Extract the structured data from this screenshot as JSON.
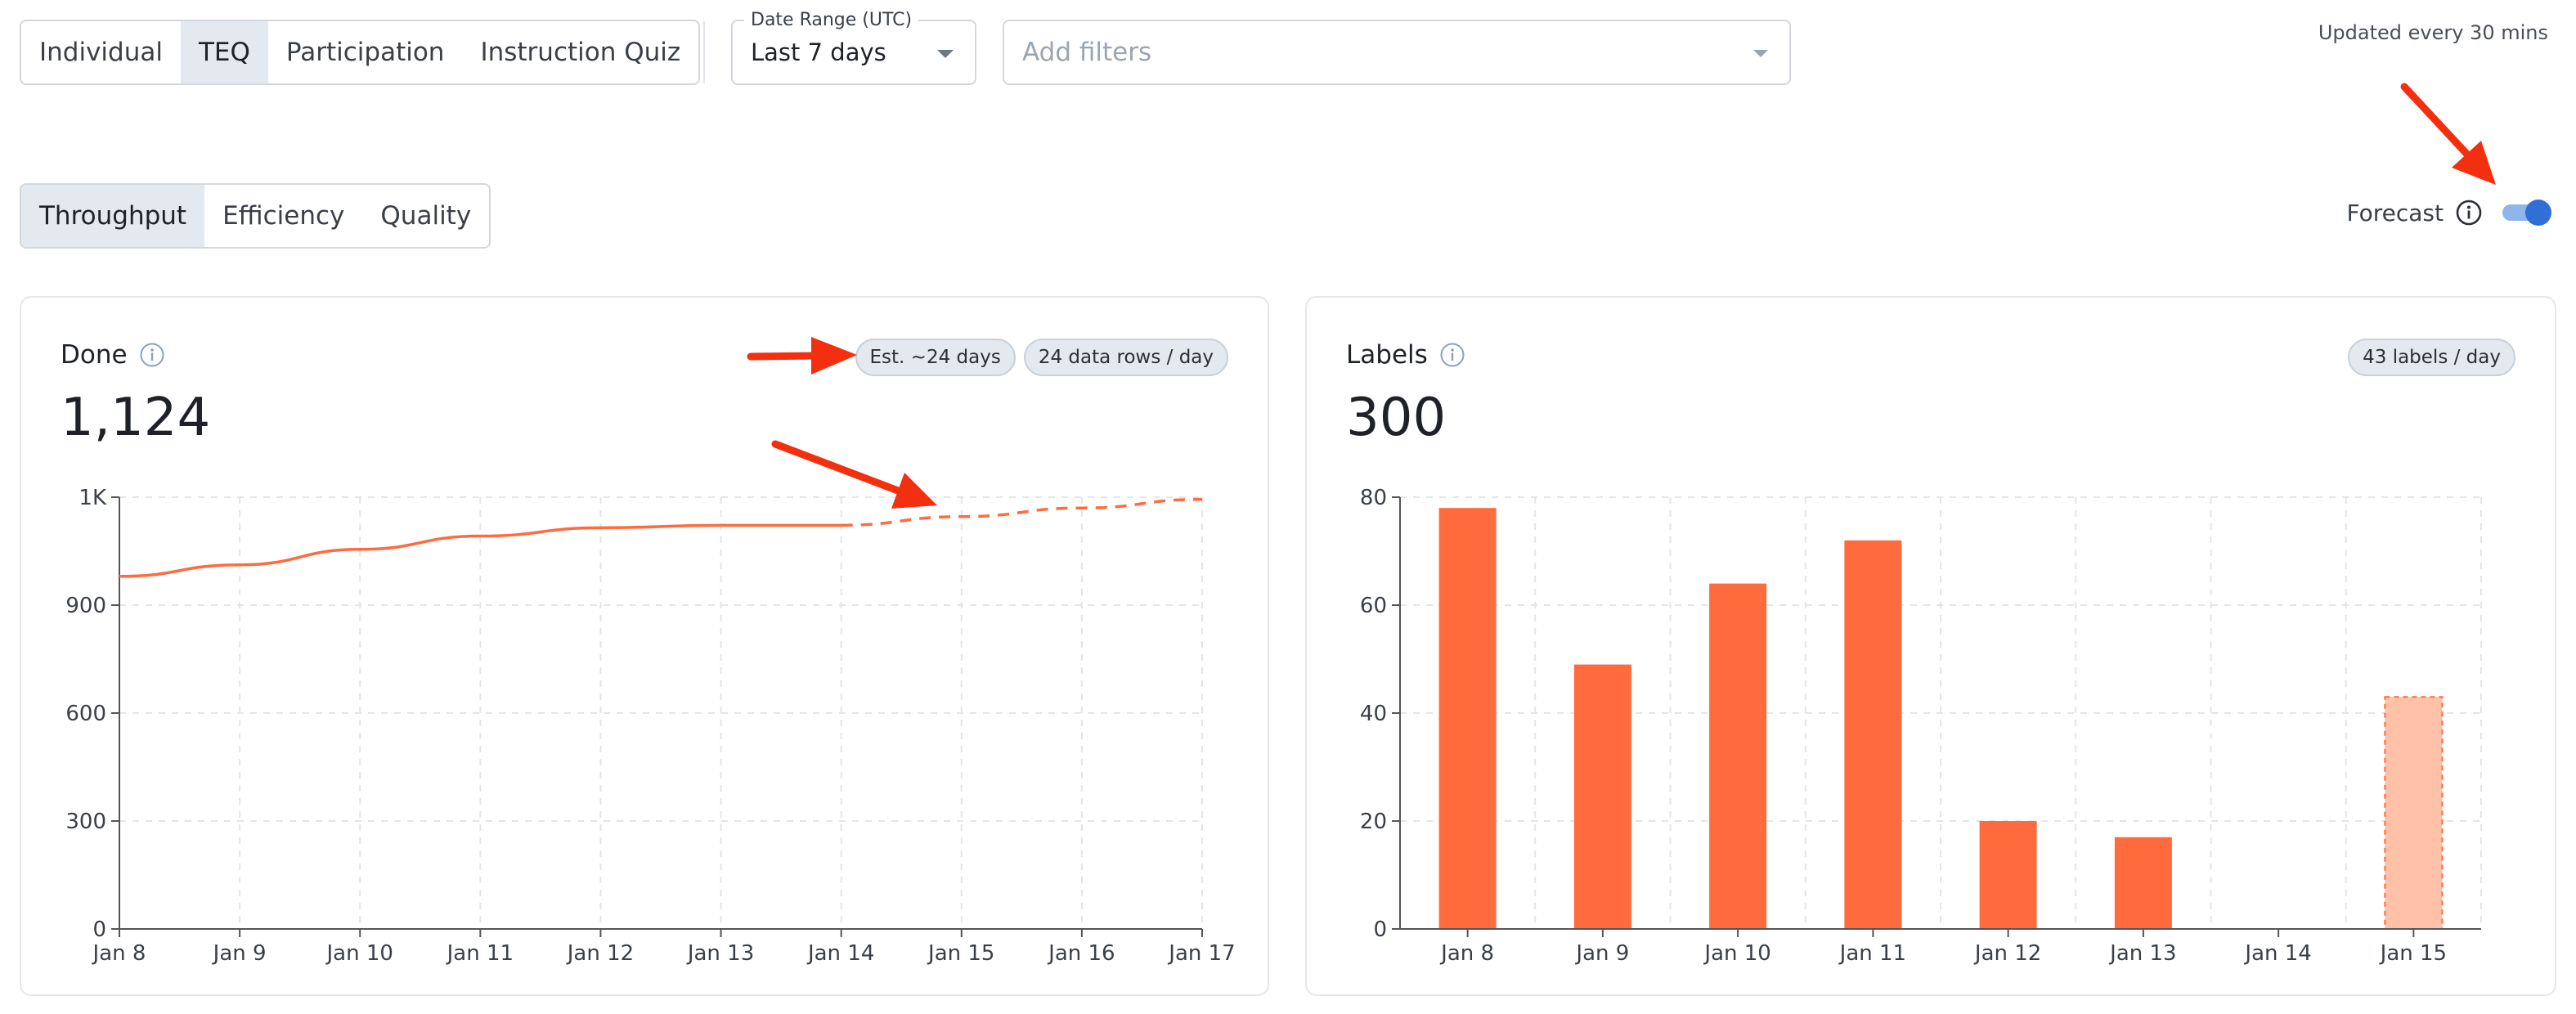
{
  "report_tabs": [
    {
      "label": "Individual",
      "active": false
    },
    {
      "label": "TEQ",
      "active": true
    },
    {
      "label": "Participation",
      "active": false
    },
    {
      "label": "Instruction Quiz",
      "active": false
    }
  ],
  "date_range": {
    "legend": "Date Range (UTC)",
    "value": "Last 7 days"
  },
  "filters": {
    "placeholder": "Add filters"
  },
  "updated_text": "Updated every 30 mins",
  "metric_tabs": [
    {
      "label": "Throughput",
      "active": true
    },
    {
      "label": "Efficiency",
      "active": false
    },
    {
      "label": "Quality",
      "active": false
    }
  ],
  "forecast": {
    "label": "Forecast",
    "enabled": true
  },
  "colors": {
    "series": "#ff6b3d",
    "forecast_bar": "#ffc2a8",
    "toggle": "#2f6fd6",
    "annotation": "#f2300f"
  },
  "done_card": {
    "title": "Done",
    "value": "1,124",
    "badges": [
      "Est. ~24 days",
      "24 data rows / day"
    ]
  },
  "labels_card": {
    "title": "Labels",
    "value": "300",
    "badges": [
      "43 labels / day"
    ]
  },
  "chart_data": [
    {
      "type": "line",
      "title": "Done",
      "x": [
        "Jan 8",
        "Jan 9",
        "Jan 10",
        "Jan 11",
        "Jan 12",
        "Jan 13",
        "Jan 14",
        "Jan 15",
        "Jan 16",
        "Jan 17"
      ],
      "x_tick_labels": [
        "Jan 8",
        "Jan 9",
        "Jan 10",
        "Jan 11",
        "Jan 12",
        "Jan 13",
        "Jan 14",
        "Jan 15",
        "Jan 16",
        "Jan 17"
      ],
      "y_tick_labels": [
        "0",
        "300",
        "600",
        "900",
        "1K"
      ],
      "y_ticks": [
        0,
        300,
        600,
        900,
        1200
      ],
      "ylim": [
        0,
        1200
      ],
      "grid": true,
      "series": [
        {
          "x": [
            "Jan 8",
            "Jan 9",
            "Jan 10",
            "Jan 11",
            "Jan 12",
            "Jan 13",
            "Jan 14"
          ],
          "values": [
            980,
            1012,
            1055,
            1092,
            1115,
            1122,
            1122
          ]
        },
        {
          "forecast": true,
          "x": [
            "Jan 14",
            "Jan 15",
            "Jan 16",
            "Jan 17"
          ],
          "values": [
            1122,
            1146,
            1170,
            1194
          ]
        }
      ]
    },
    {
      "type": "bar",
      "title": "Labels",
      "categories": [
        "Jan 8",
        "Jan 9",
        "Jan 10",
        "Jan 11",
        "Jan 12",
        "Jan 13",
        "Jan 14",
        "Jan 15"
      ],
      "values": [
        78,
        49,
        64,
        72,
        20,
        17,
        0,
        43
      ],
      "forecast_index": 7,
      "y_tick_labels": [
        "0",
        "20",
        "40",
        "60",
        "80"
      ],
      "y_ticks": [
        0,
        20,
        40,
        60,
        80
      ],
      "ylim": [
        0,
        80
      ],
      "grid": true
    }
  ]
}
